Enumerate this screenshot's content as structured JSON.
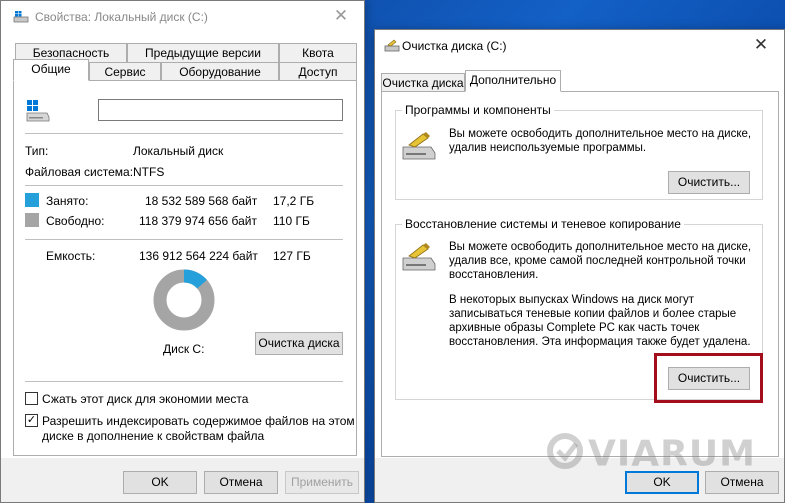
{
  "left_window": {
    "title": "Свойства: Локальный диск (C:)",
    "tabs_row1": [
      "Безопасность",
      "Предыдущие версии",
      "Квота"
    ],
    "tabs_row2": [
      "Общие",
      "Сервис",
      "Оборудование",
      "Доступ"
    ],
    "active_tab": "Общие",
    "name_input_value": "",
    "type_label": "Тип:",
    "type_value": "Локальный диск",
    "fs_label": "Файловая система:",
    "fs_value": "NTFS",
    "used_label": "Занято:",
    "used_bytes": "18 532 589 568 байт",
    "used_size": "17,2 ГБ",
    "used_color": "#26a0da",
    "free_label": "Свободно:",
    "free_bytes": "118 379 974 656 байт",
    "free_size": "110 ГБ",
    "free_color": "#a5a5a5",
    "capacity_label": "Емкость:",
    "capacity_bytes": "136 912 564 224 байт",
    "capacity_size": "127 ГБ",
    "used_fraction": 0.1354,
    "disk_label": "Диск C:",
    "cleanup_button": "Очистка диска",
    "compress_checkbox": {
      "label": "Сжать этот диск для экономии места",
      "checked": false
    },
    "index_checkbox": {
      "label_line1": "Разрешить индексировать содержимое файлов на этом",
      "label_line2": "диске в дополнение к свойствам файла",
      "checked": true
    },
    "ok_button": "OK",
    "cancel_button": "Отмена",
    "apply_button": "Применить"
  },
  "right_window": {
    "title": "Очистка диска  (C:)",
    "tabs": [
      "Очистка диска",
      "Дополнительно"
    ],
    "active_tab": "Дополнительно",
    "group1": {
      "title": "Программы и компоненты",
      "desc_line1": "Вы можете освободить дополнительное место на диске,",
      "desc_line2": "удалив неиспользуемые программы.",
      "button": "Очистить..."
    },
    "group2": {
      "title": "Восстановление системы и теневое копирование",
      "desc_line1": "Вы можете освободить дополнительное место на диске,",
      "desc_line2": "удалив все, кроме самой последней контрольной точки",
      "desc_line3": "восстановления.",
      "note_line1": "В некоторых выпусках Windows на диск могут",
      "note_line2": "записываться теневые копии файлов и более старые",
      "note_line3": "архивные образы Complete PC как часть точек",
      "note_line4": "восстановления. Эта информация также будет удалена.",
      "button": "Очистить..."
    },
    "ok_button": "OK",
    "cancel_button": "Отмена"
  },
  "watermark": "VIARUM",
  "icons": {
    "drive_icon": "windows-drive-icon",
    "cleanup_icon": "disk-cleanup-icon",
    "close_icon": "close-icon",
    "checkmark": "✓"
  }
}
